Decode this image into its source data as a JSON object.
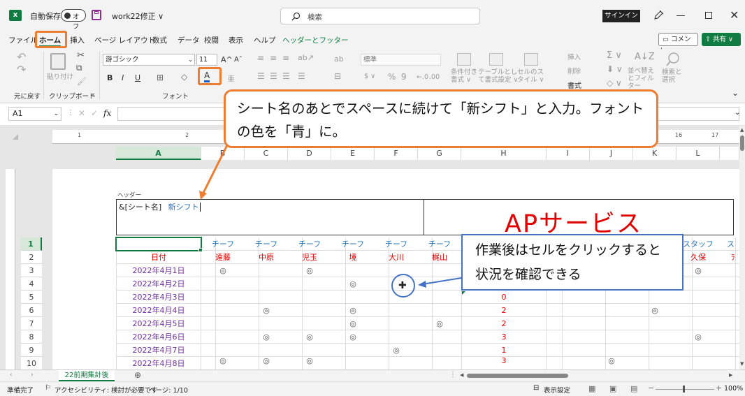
{
  "titlebar": {
    "autosave_label": "自動保存",
    "autosave_state": "オフ",
    "filename": "work22修正 ∨",
    "search_placeholder": "検索",
    "signin_label": "サインイン"
  },
  "menu": {
    "items": [
      "ファイル",
      "ホーム",
      "挿入",
      "ページ レイアウト",
      "数式",
      "データ",
      "校閲",
      "表示",
      "ヘルプ",
      "ヘッダーとフッター"
    ],
    "comment_label": "コメント",
    "share_label": "共有 ∨"
  },
  "ribbon": {
    "undo_label": "元に戻す",
    "paste_label": "貼り付け",
    "clipboard_label": "クリップボード",
    "font_name": "游ゴシック",
    "font_size": "11",
    "font_group_label": "フォント",
    "bold": "B",
    "italic": "I",
    "underline": "U",
    "font_color_glyph": "A",
    "number_format": "標準",
    "percent": "%",
    "comma": "9",
    "cond_format": "条件付き書式 ∨",
    "table_format": "テーブルとして書式設定 ∨",
    "cell_style": "セルのスタイル ∨",
    "insert": "挿入",
    "delete": "削除",
    "format": "書式",
    "sort_filter": "並べ替えとフィルター",
    "find_select": "検索と選択"
  },
  "formula": {
    "namebox": "A1",
    "fx": "fx"
  },
  "ruler": [
    "1",
    "2",
    "16",
    "17"
  ],
  "columns": [
    "A",
    "B",
    "C",
    "D",
    "E",
    "F",
    "G",
    "H",
    "I",
    "J",
    "K",
    "L"
  ],
  "rows": [
    "1",
    "2",
    "3",
    "4",
    "5",
    "6",
    "7",
    "8",
    "9",
    "10"
  ],
  "header_area": {
    "label": "ヘッダー",
    "code": "&[シート名]",
    "new_text": "新シフト",
    "center_text": "APサービス"
  },
  "row1": [
    "チーフ",
    "チーフ",
    "チーフ",
    "チーフ",
    "チーフ",
    "チーフ",
    "スタッフ",
    "ス"
  ],
  "row2": [
    "日付",
    "遠藤",
    "中原",
    "児玉",
    "境",
    "大川",
    "梶山",
    "久保",
    "ﾗ"
  ],
  "dates": [
    "2022年4月1日",
    "2022年4月2日",
    "2022年4月3日",
    "2022年4月4日",
    "2022年4月5日",
    "2022年4月6日",
    "2022年4月7日",
    "2022年4月8日"
  ],
  "h_values": [
    "0",
    "2",
    "2",
    "3",
    "1",
    "3"
  ],
  "mark": "◎",
  "tab": {
    "sheet_name": "22前期集計後"
  },
  "status": {
    "ready": "準備完了",
    "accessibility": "アクセシビリティ: 検討が必要です",
    "page": "ページ: 1/10",
    "display_settings": "表示設定",
    "zoom": "100%"
  },
  "callouts": {
    "top": "シート名のあとでスペースに続けて「新シフト」と入力。フォントの色を「青」に。",
    "bottom": "作業後はセルをクリックすると状況を確認できる"
  },
  "colors": {
    "accent_orange": "#ed7d31",
    "excel_green": "#107c41",
    "date_purple": "#7030a0",
    "red": "#e00000",
    "blue_text": "#2e75b6",
    "callout_blue": "#4472c4"
  }
}
